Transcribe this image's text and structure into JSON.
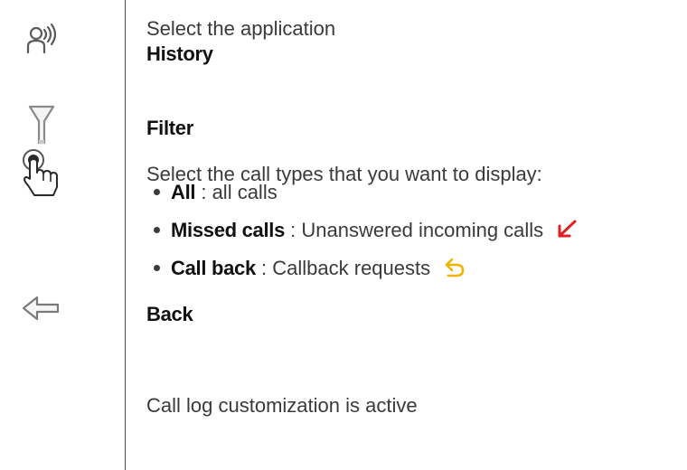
{
  "step1": {
    "instruction": "Select the application",
    "app_name": "History"
  },
  "step2": {
    "label": "Filter"
  },
  "step3": {
    "instruction": "Select the call types that you want to display:",
    "options": [
      {
        "name": "All",
        "desc": ": all calls"
      },
      {
        "name": "Missed calls",
        "desc": ": Unanswered incoming calls"
      },
      {
        "name": "Call back",
        "desc": ": Callback requests"
      }
    ]
  },
  "step4": {
    "label": "Back"
  },
  "status": {
    "text": "Call log customization is active"
  },
  "colors": {
    "missed_arrow": "#e02020",
    "callback_arrow": "#f0b400"
  },
  "icons": {
    "history": "history-app-icon",
    "filter": "filter-icon",
    "touch": "touch-hand-icon",
    "back": "back-arrow-icon",
    "missed": "missed-call-arrow-icon",
    "callback": "callback-arrow-icon"
  }
}
